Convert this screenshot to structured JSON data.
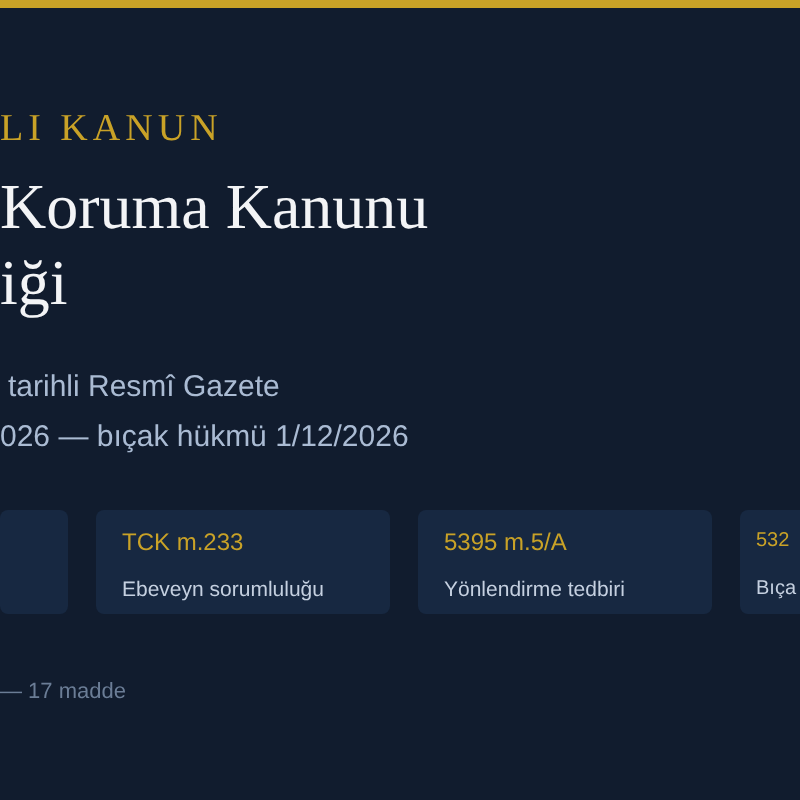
{
  "kicker": "LI KANUN",
  "title": [
    "Koruma Kanunu",
    "iği"
  ],
  "subtitle": [
    "tarihli Resmî Gazete",
    "026 — bıçak hükmü 1/12/2026"
  ],
  "cards": [
    {
      "kind": "clipped"
    },
    {
      "kind": "full",
      "ref": "TCK m.233",
      "label": "Ebeveyn sorumluluğu"
    },
    {
      "kind": "full",
      "ref": "5395 m.5/A",
      "label": "Yönlendirme tedbiri"
    },
    {
      "kind": "edge",
      "ref": "532",
      "label": "Bıça"
    }
  ],
  "footer": "— 17 madde"
}
